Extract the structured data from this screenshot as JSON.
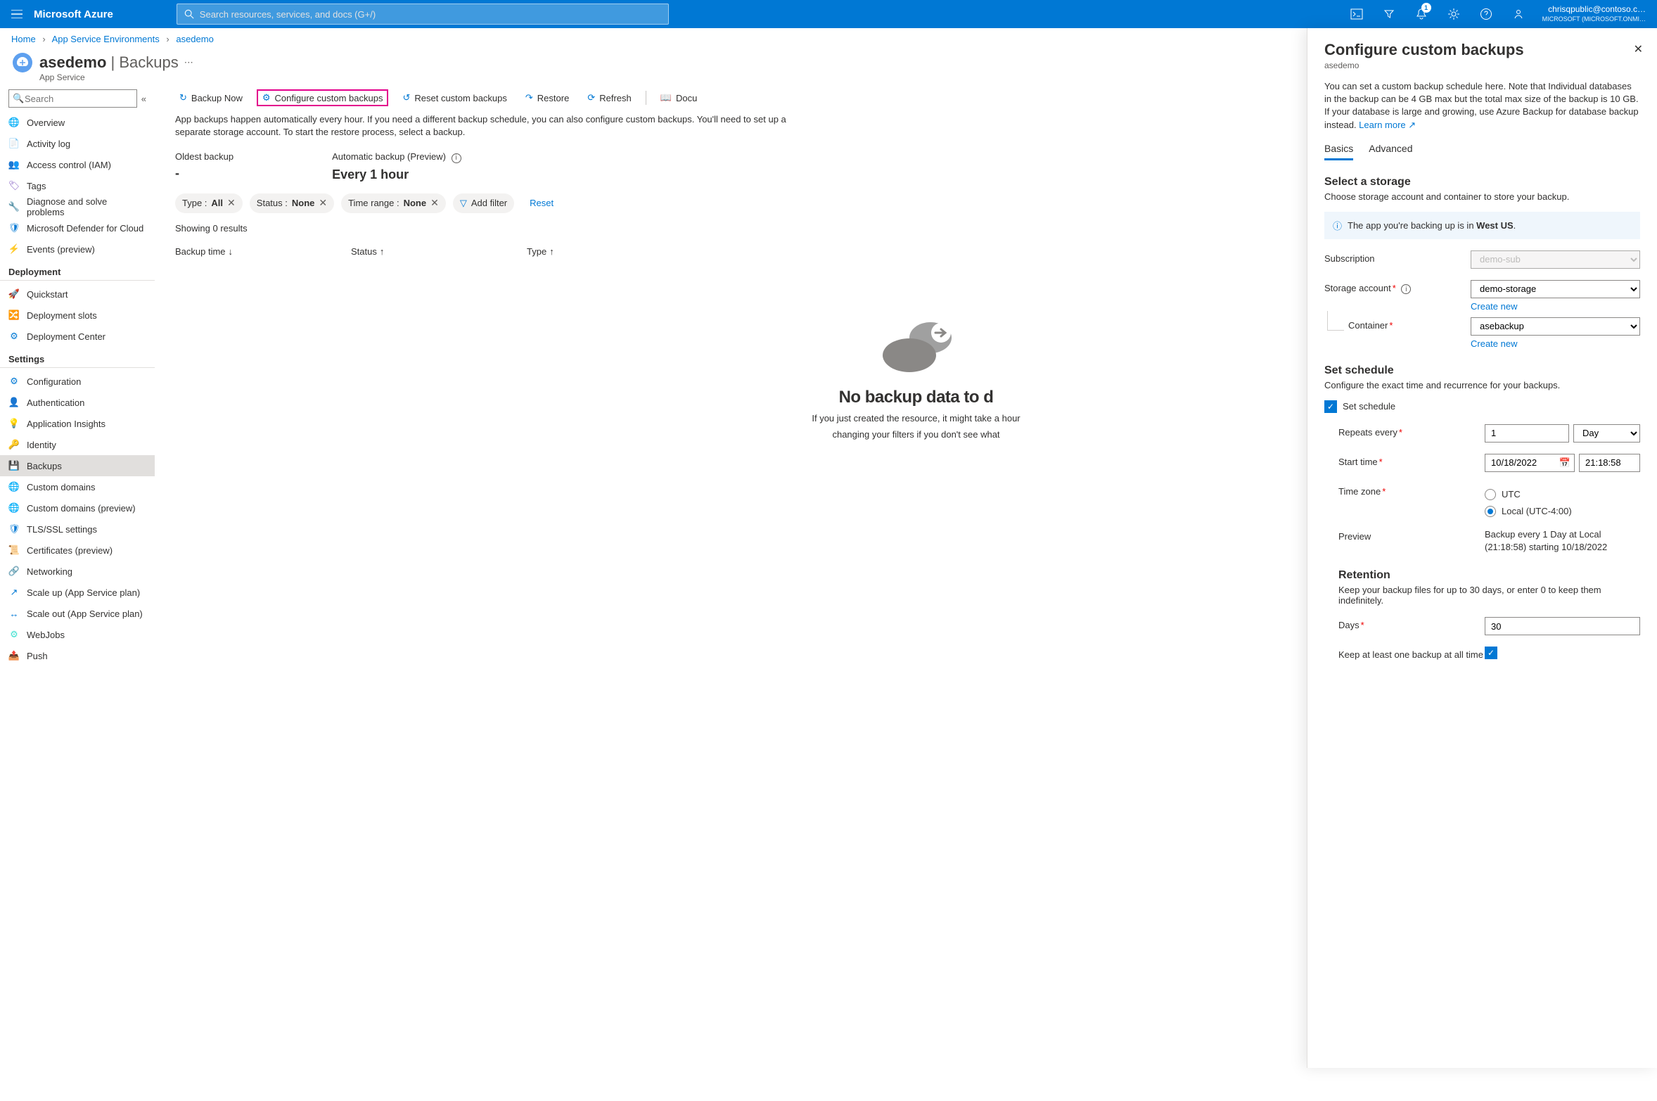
{
  "topbar": {
    "brand": "Microsoft Azure",
    "search_placeholder": "Search resources, services, and docs (G+/)",
    "notification_badge": "1",
    "account_email": "chrisqpublic@contoso.c…",
    "account_tenant": "MICROSOFT (MICROSOFT.ONMI…"
  },
  "breadcrumb": {
    "items": [
      "Home",
      "App Service Environments",
      "asedemo"
    ]
  },
  "header": {
    "name": "asedemo",
    "section": "Backups",
    "type": "App Service"
  },
  "menu_search_placeholder": "Search",
  "menu_top": [
    {
      "label": "Overview",
      "icon": "🌐",
      "color": "#0078d4"
    },
    {
      "label": "Activity log",
      "icon": "📄",
      "color": "#0078d4"
    },
    {
      "label": "Access control (IAM)",
      "icon": "👥",
      "color": "#e3008c"
    },
    {
      "label": "Tags",
      "icon": "🏷",
      "color": "#8661c5"
    },
    {
      "label": "Diagnose and solve problems",
      "icon": "🔧",
      "color": "#605e5c"
    },
    {
      "label": "Microsoft Defender for Cloud",
      "icon": "🛡",
      "color": "#0078d4"
    },
    {
      "label": "Events (preview)",
      "icon": "⚡",
      "color": "#ffaa44"
    }
  ],
  "menu_groups": [
    {
      "title": "Deployment",
      "items": [
        {
          "label": "Quickstart",
          "icon": "🚀",
          "color": "#0078d4"
        },
        {
          "label": "Deployment slots",
          "icon": "🔀",
          "color": "#0078d4"
        },
        {
          "label": "Deployment Center",
          "icon": "⚙",
          "color": "#0078d4"
        }
      ]
    },
    {
      "title": "Settings",
      "items": [
        {
          "label": "Configuration",
          "icon": "⚙",
          "color": "#0078d4"
        },
        {
          "label": "Authentication",
          "icon": "👤",
          "color": "#0078d4"
        },
        {
          "label": "Application Insights",
          "icon": "💡",
          "color": "#8661c5"
        },
        {
          "label": "Identity",
          "icon": "🔑",
          "color": "#ffaa44"
        },
        {
          "label": "Backups",
          "icon": "💾",
          "color": "#0078d4",
          "active": true
        },
        {
          "label": "Custom domains",
          "icon": "🌐",
          "color": "#0078d4"
        },
        {
          "label": "Custom domains (preview)",
          "icon": "🌐",
          "color": "#0078d4"
        },
        {
          "label": "TLS/SSL settings",
          "icon": "🛡",
          "color": "#0078d4"
        },
        {
          "label": "Certificates (preview)",
          "icon": "📜",
          "color": "#0078d4"
        },
        {
          "label": "Networking",
          "icon": "🔗",
          "color": "#0078d4"
        },
        {
          "label": "Scale up (App Service plan)",
          "icon": "↗",
          "color": "#0078d4"
        },
        {
          "label": "Scale out (App Service plan)",
          "icon": "↔",
          "color": "#0078d4"
        },
        {
          "label": "WebJobs",
          "icon": "⚙",
          "color": "#40e0d0"
        },
        {
          "label": "Push",
          "icon": "📤",
          "color": "#107c10"
        }
      ]
    }
  ],
  "toolbar": {
    "backup_now": "Backup Now",
    "configure": "Configure custom backups",
    "reset": "Reset custom backups",
    "restore": "Restore",
    "refresh": "Refresh",
    "docs": "Docu"
  },
  "description": "App backups happen automatically every hour. If you need a different backup schedule, you can also configure custom backups. You'll need to set up a separate storage account. To start the restore process, select a backup.",
  "summary": {
    "oldest_label": "Oldest backup",
    "oldest_value": "-",
    "auto_label": "Automatic backup (Preview)",
    "auto_value": "Every 1 hour"
  },
  "filters": {
    "type_label": "Type : ",
    "type_value": "All",
    "status_label": "Status : ",
    "status_value": "None",
    "timerange_label": "Time range : ",
    "timerange_value": "None",
    "add": "Add filter",
    "reset": "Reset"
  },
  "showing": "Showing 0 results",
  "columns": {
    "time": "Backup time",
    "status": "Status",
    "type": "Type"
  },
  "empty": {
    "title": "No backup data to d",
    "text1": "If you just created the resource, it might take a hour ",
    "text2": "changing your filters if you don't see what "
  },
  "panel": {
    "title": "Configure custom backups",
    "sub": "asedemo",
    "description": "You can set a custom backup schedule here. Note that Individual databases in the backup can be 4 GB max but the total max size of the backup is 10 GB. If your database is large and growing, use Azure Backup for database backup instead.",
    "learn_more": "Learn more",
    "tabs": {
      "basics": "Basics",
      "advanced": "Advanced"
    },
    "storage_title": "Select a storage",
    "storage_hint": "Choose storage account and container to store your backup.",
    "info_prefix": "The app you're backing up is in ",
    "info_region": "West US",
    "subscription_label": "Subscription",
    "subscription_value": "demo-sub",
    "storage_account_label": "Storage account",
    "storage_account_value": "demo-storage",
    "create_new": "Create new",
    "container_label": "Container",
    "container_value": "asebackup",
    "schedule_title": "Set schedule",
    "schedule_hint": "Configure the exact time and recurrence for your backups.",
    "schedule_checkbox": "Set schedule",
    "repeats_label": "Repeats every",
    "repeats_value": "1",
    "repeats_unit": "Day",
    "start_label": "Start time",
    "start_date": "10/18/2022",
    "start_time": "21:18:58",
    "timezone_label": "Time zone",
    "tz_utc": "UTC",
    "tz_local": "Local (UTC-4:00)",
    "preview_label": "Preview",
    "preview_text": "Backup every 1 Day at Local (21:18:58) starting 10/18/2022",
    "retention_title": "Retention",
    "retention_hint": "Keep your backup files for up to 30 days, or enter 0 to keep them indefinitely.",
    "days_label": "Days",
    "days_value": "30",
    "keep_one_label": "Keep at least one backup at all time"
  }
}
